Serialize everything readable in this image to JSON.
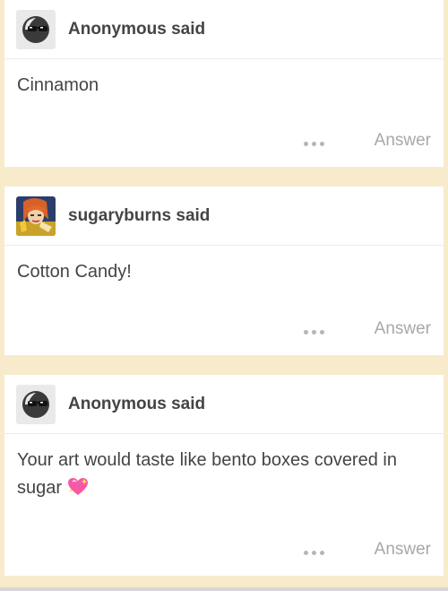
{
  "asks": [
    {
      "asker": "Anonymous",
      "said": "said",
      "avatar_icon": "anonymous-sunglasses-icon",
      "question": "Cinnamon",
      "more_icon": "ellipsis-icon",
      "answer_label": "Answer"
    },
    {
      "asker": "sugaryburns",
      "said": "said",
      "avatar_icon": "user-avatar-illustration",
      "question": "Cotton Candy!",
      "more_icon": "ellipsis-icon",
      "answer_label": "Answer"
    },
    {
      "asker": "Anonymous",
      "said": "said",
      "avatar_icon": "anonymous-sunglasses-icon",
      "question": "Your art would taste like bento boxes covered in sugar",
      "emoji": "sparkling-heart-emoji",
      "more_icon": "ellipsis-icon",
      "answer_label": "Answer"
    }
  ],
  "colors": {
    "feed_background": "#f8ebcc",
    "card_background": "#ffffff",
    "text_primary": "#444444",
    "text_muted": "#a8a8a8",
    "heart_pink": "#f55aa6"
  }
}
